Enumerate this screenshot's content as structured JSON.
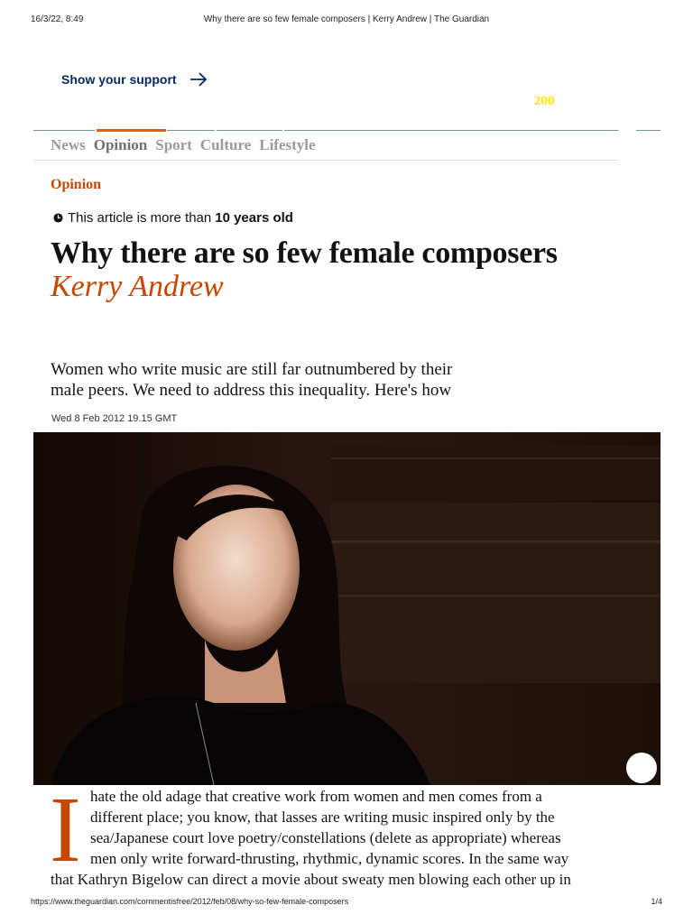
{
  "print": {
    "datetime": "16/3/22, 8:49",
    "doc_title": "Why there are so few female composers | Kerry Andrew | The Guardian",
    "url": "https://www.theguardian.com/commentisfree/2012/feb/08/why-so-few-female-composers",
    "page": "1/4"
  },
  "support": {
    "label": "Show your support",
    "icon": "arrow-right-icon"
  },
  "badge": {
    "text": "200"
  },
  "colors": {
    "brand": "#052962",
    "opinion": "#c74600",
    "accent": "#e05e00",
    "badge": "#ffe500"
  },
  "nav": {
    "items": [
      "News",
      "Opinion",
      "Sport",
      "Culture",
      "Lifestyle"
    ],
    "active": "Opinion"
  },
  "article": {
    "section": "Opinion",
    "age_notice_prefix": "This article is more than",
    "age_notice_strong": "10 years old",
    "headline": "Why there are so few female composers",
    "byline": "Kerry Andrew",
    "standfirst_lines": [
      "Women who write music are still far outnumbered by their",
      "male peers. We need to address this inequality. Here's how"
    ],
    "dateline": "Wed 8 Feb 2012 19.15 GMT",
    "dropcap": "I",
    "body_lines": [
      "hate the old adage that creative work from women and men comes from a",
      "different place; you know, that lasses are writing music inspired only by the",
      "sea/Japanese court love poetry/constellations (delete as appropriate) whereas",
      "men only write forward-thrusting, rhythmic, dynamic scores. In the same way",
      "that Kathryn Bigelow can direct a movie about sweaty men blowing each other up in"
    ]
  }
}
